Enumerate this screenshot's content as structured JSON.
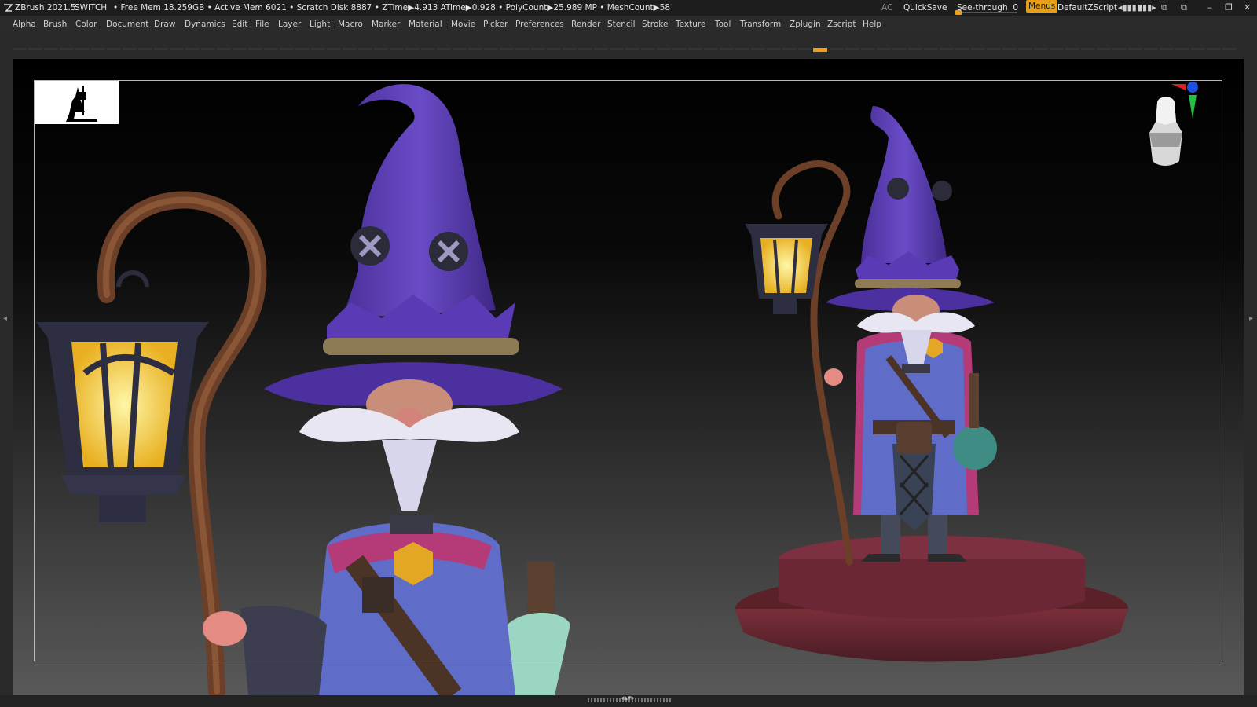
{
  "titlebar": {
    "app_title": "ZBrush 2021.5",
    "switch_label": "SWITCH",
    "status": "• Free Mem 18.259GB • Active Mem 6021 • Scratch Disk 8887 •  ZTime▶4.913 ATime▶0.928 • PolyCount▶25.989 MP  • MeshCount▶58",
    "ac_label": "AC",
    "quicksave_label": "QuickSave",
    "seethrough_label": "See-through",
    "seethrough_value": "0",
    "seethrough_level": 0,
    "menus_label": "Menus",
    "default_zscript_label": "DefaultZScript"
  },
  "menubar": {
    "items": [
      "Alpha",
      "Brush",
      "Color",
      "Document",
      "Draw",
      "Dynamics",
      "Edit",
      "File",
      "Layer",
      "Light",
      "Macro",
      "Marker",
      "Material",
      "Movie",
      "Picker",
      "Preferences",
      "Render",
      "Stencil",
      "Stroke",
      "Texture",
      "Tool",
      "Transform",
      "Zplugin",
      "Zscript",
      "Help"
    ]
  },
  "colors": {
    "accent": "#f0a020",
    "hat_purple": "#5b3fb0",
    "robe_blue": "#5f6dc8",
    "cape_magenta": "#b43a78",
    "staff_brown": "#6b3f28",
    "lantern_glow": "#ffd94a",
    "base_maroon": "#6a2a33"
  },
  "icons": [
    "zbrush-logo-icon",
    "layout-icon",
    "layout-alt-icon",
    "window-icon",
    "restore-icon",
    "minimize-icon",
    "maximize-icon",
    "close-icon"
  ]
}
